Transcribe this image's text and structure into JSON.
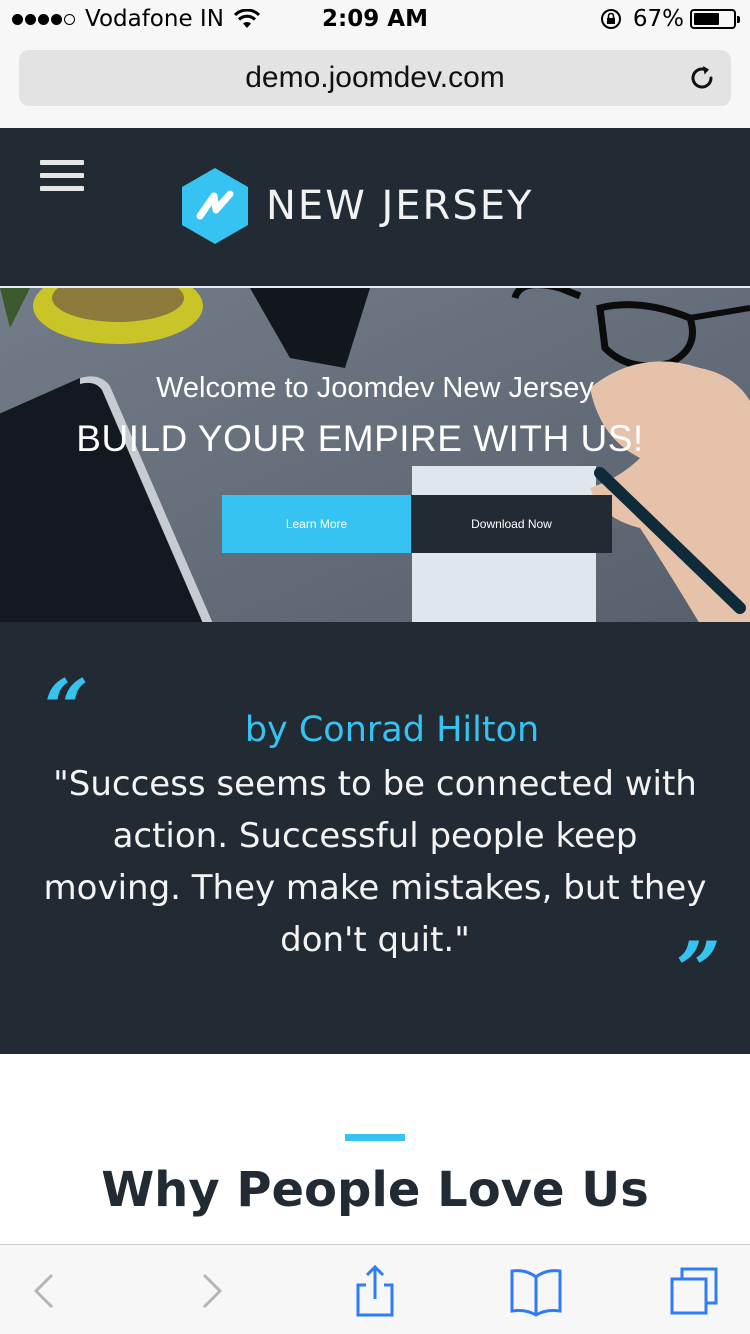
{
  "status_bar": {
    "carrier": "Vodafone IN",
    "time": "2:09 AM",
    "battery": "67%",
    "battery_level": 0.67,
    "signal_bars_filled": 4,
    "signal_bars_total": 5
  },
  "browser": {
    "url": "demo.joomdev.com"
  },
  "header": {
    "logo_text": "NEW JERSEY",
    "colors": {
      "background": "#222a33",
      "accent": "#37c3f2"
    }
  },
  "hero": {
    "subtitle": "Welcome to Joomdev New Jersey",
    "title": "BUILD YOUR EMPIRE WITH US!",
    "learn_more_label": "Learn More",
    "download_label": "Download Now"
  },
  "quote": {
    "author": "by Conrad Hilton",
    "text": "\"Success seems to be connected with action. Successful people keep moving. They make mistakes, but they don't quit.\"",
    "open_mark": "“",
    "close_mark": "”"
  },
  "section": {
    "title": "Why People Love Us"
  },
  "toolbar": {
    "icons": [
      "back-icon",
      "forward-icon",
      "share-icon",
      "bookmarks-icon",
      "tabs-icon"
    ]
  }
}
